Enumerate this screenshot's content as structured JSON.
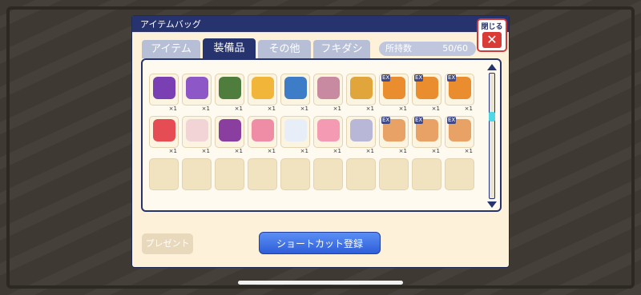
{
  "dialog": {
    "title": "アイテムバッグ",
    "close_label": "閉じる",
    "close_symbol": "✕"
  },
  "tabs": [
    {
      "label": "アイテム",
      "active": false
    },
    {
      "label": "装備品",
      "active": true
    },
    {
      "label": "その他",
      "active": false
    },
    {
      "label": "フキダシ",
      "active": false
    }
  ],
  "inventory": {
    "count_label": "所持数",
    "count_value": "50/60"
  },
  "rows": [
    [
      {
        "icon": "purple-dragon-armor-icon",
        "qty": "×1",
        "color": "#7a3fb2"
      },
      {
        "icon": "purple-dragon-armor-icon",
        "qty": "×1",
        "color": "#8d57c7"
      },
      {
        "icon": "green-dragon-armor-icon",
        "qty": "×1",
        "color": "#4f7d3d"
      },
      {
        "icon": "golden-bun-icon",
        "qty": "×1",
        "color": "#f1b53a"
      },
      {
        "icon": "blue-robot-icon",
        "qty": "×1",
        "color": "#3d7dc7"
      },
      {
        "icon": "pink-cat-figure-icon",
        "qty": "×1",
        "color": "#c88aa1"
      },
      {
        "icon": "golden-lizard-icon",
        "qty": "×1",
        "color": "#e0a53b"
      },
      {
        "icon": "orange-ex-cat-icon",
        "qty": "×1",
        "color": "#e98d2f",
        "badge": "EX"
      },
      {
        "icon": "orange-ex-cat-icon",
        "qty": "×1",
        "color": "#e98d2f",
        "badge": "EX"
      },
      {
        "icon": "orange-ex-cat-icon",
        "qty": "×1",
        "color": "#e98d2f",
        "badge": "EX"
      }
    ],
    [
      {
        "icon": "strawberry-icon",
        "qty": "×1",
        "color": "#e64c53"
      },
      {
        "icon": "white-fluff-icon",
        "qty": "×1",
        "color": "#f2d4d6"
      },
      {
        "icon": "purple-armor-icon",
        "qty": "×1",
        "color": "#8a3fa0"
      },
      {
        "icon": "pink-cake-icon",
        "qty": "×1",
        "color": "#f08da6"
      },
      {
        "icon": "white-cloud-icon",
        "qty": "×1",
        "color": "#e7eef7"
      },
      {
        "icon": "pink-flower-icon",
        "qty": "×1",
        "color": "#f59ab3"
      },
      {
        "icon": "white-robe-icon",
        "qty": "×1",
        "color": "#b8b7d8"
      },
      {
        "icon": "orange-white-cat-icon",
        "qty": "×1",
        "color": "#e8a265",
        "badge": "EX"
      },
      {
        "icon": "orange-white-cat-icon",
        "qty": "×1",
        "color": "#e8a265",
        "badge": "EX"
      },
      {
        "icon": "orange-white-cat-icon",
        "qty": "×1",
        "color": "#e8a265",
        "badge": "EX"
      }
    ],
    [
      {
        "icon": "empty-slot",
        "qty": "",
        "color": "#f1e2c0"
      },
      {
        "icon": "empty-slot",
        "qty": "",
        "color": "#f1e2c0"
      },
      {
        "icon": "empty-slot",
        "qty": "",
        "color": "#f1e2c0"
      },
      {
        "icon": "empty-slot",
        "qty": "",
        "color": "#f1e2c0"
      },
      {
        "icon": "empty-slot",
        "qty": "",
        "color": "#f1e2c0"
      },
      {
        "icon": "empty-slot",
        "qty": "",
        "color": "#f1e2c0"
      },
      {
        "icon": "empty-slot",
        "qty": "",
        "color": "#f1e2c0"
      },
      {
        "icon": "empty-slot",
        "qty": "",
        "color": "#f1e2c0"
      },
      {
        "icon": "empty-slot",
        "qty": "",
        "color": "#f1e2c0"
      },
      {
        "icon": "empty-slot",
        "qty": "",
        "color": "#f1e2c0"
      }
    ]
  ],
  "footer": {
    "present_label": "プレゼント",
    "shortcut_label": "ショートカット登録"
  }
}
